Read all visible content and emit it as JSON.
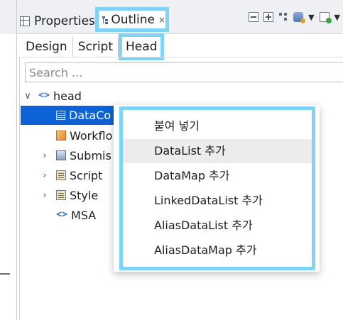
{
  "view_tabs": {
    "properties_label": "Properties",
    "outline_label": "Outline",
    "close_glyph": "×"
  },
  "sub_tabs": [
    "Design",
    "Script",
    "Head"
  ],
  "search": {
    "placeholder": "Search ..."
  },
  "tree": {
    "twisty_expanded": "∨",
    "twisty_collapsed": "›",
    "code_glyph": "<>",
    "root": "head",
    "items": [
      "DataCo",
      "Workflo",
      "Submis",
      "Script",
      "Style",
      "MSA"
    ]
  },
  "context_menu": {
    "items": [
      "붙여 넣기",
      "DataList 추가",
      "DataMap 추가",
      "LinkedDataList 추가",
      "AliasDataList 추가",
      "AliasDataMap 추가"
    ],
    "hovered_index": 1
  },
  "colors": {
    "highlight_frame": "#7fd3f7",
    "selection": "#0d63d6",
    "hover": "#ececec"
  }
}
